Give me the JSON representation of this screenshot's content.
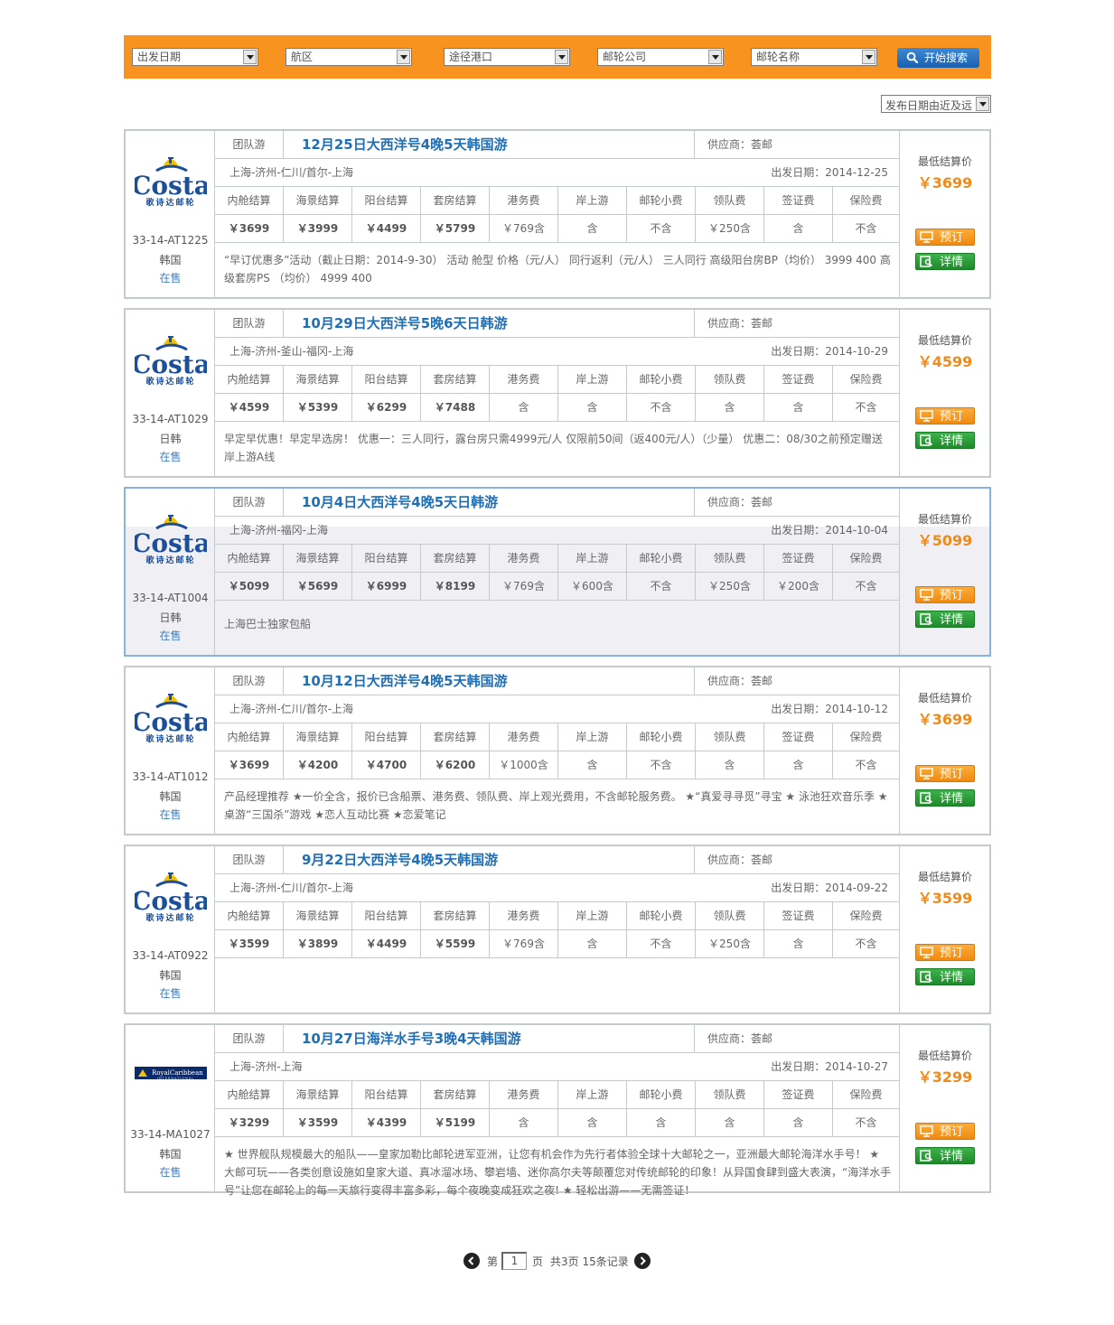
{
  "search": {
    "filters": [
      "出发日期",
      "航区",
      "途径港口",
      "邮轮公司",
      "邮轮名称"
    ],
    "button_label": "开始搜索",
    "sort_label": "发布日期由近及远"
  },
  "columns": [
    "内舱结算",
    "海景结算",
    "阳台结算",
    "套房结算",
    "港务费",
    "岸上游",
    "邮轮小费",
    "领队费",
    "签证费",
    "保险费"
  ],
  "labels": {
    "price_label": "最低结算价",
    "book": "预订",
    "detail": "详情",
    "status": "在售"
  },
  "colors": {
    "accent": "#f7931e",
    "title": "#1f6fb7",
    "price": "#f08a1a",
    "book_btn": "#f5a020",
    "detail_btn": "#2d9a3a"
  },
  "cruises": [
    {
      "logo": "Costa",
      "logo_text": "歌诗达邮轮",
      "code": "33-14-AT1225",
      "dest": "韩国",
      "type": "团队游",
      "title": "12月25日大西洋号4晚5天韩国游",
      "supplier": "供应商：荟邮",
      "route": "上海-济州-仁川/首尔-上海",
      "depart": "出发日期：2014-12-25",
      "prices": [
        "￥3699",
        "￥3999",
        "￥4499",
        "￥5799",
        "￥769含",
        "含",
        "不含",
        "￥250含",
        "含",
        "不含"
      ],
      "desc": "“早订优惠多”活动（截止日期：2014-9-30） 活动 舱型 价格（元/人） 同行返利（元/人） 三人同行 高级阳台房BP（均价） 3999 400 高级套房PS （均价） 4999 400",
      "min_price": "￥3699"
    },
    {
      "logo": "Costa",
      "logo_text": "歌诗达邮轮",
      "code": "33-14-AT1029",
      "dest": "日韩",
      "type": "团队游",
      "title": "10月29日大西洋号5晚6天日韩游",
      "supplier": "供应商：荟邮",
      "route": "上海-济州-釜山-福冈-上海",
      "depart": "出发日期：2014-10-29",
      "prices": [
        "￥4599",
        "￥5399",
        "￥6299",
        "￥7488",
        "含",
        "含",
        "不含",
        "含",
        "含",
        "不含"
      ],
      "desc": "早定早优惠！早定早选房！ 优惠一：三人同行，露台房只需4999元/人 仅限前50间（返400元/人）（少量） 优惠二：08/30之前预定赠送岸上游A线",
      "min_price": "￥4599"
    },
    {
      "logo": "Costa",
      "logo_text": "歌诗达邮轮",
      "code": "33-14-AT1004",
      "dest": "日韩",
      "type": "团队游",
      "title": "10月4日大西洋号4晚5天日韩游",
      "supplier": "供应商：荟邮",
      "route": "上海-济州-福冈-上海",
      "depart": "出发日期：2014-10-04",
      "prices": [
        "￥5099",
        "￥5699",
        "￥6999",
        "￥8199",
        "￥769含",
        "￥600含",
        "不含",
        "￥250含",
        "￥200含",
        "不含"
      ],
      "desc": "上海巴士独家包船",
      "min_price": "￥5099"
    },
    {
      "logo": "Costa",
      "logo_text": "歌诗达邮轮",
      "code": "33-14-AT1012",
      "dest": "韩国",
      "type": "团队游",
      "title": "10月12日大西洋号4晚5天韩国游",
      "supplier": "供应商：荟邮",
      "route": "上海-济州-仁川/首尔-上海",
      "depart": "出发日期：2014-10-12",
      "prices": [
        "￥3699",
        "￥4200",
        "￥4700",
        "￥6200",
        "￥1000含",
        "含",
        "不含",
        "含",
        "含",
        "不含"
      ],
      "desc": "产品经理推荐 ★一价全含，报价已含船票、港务费、领队费、岸上观光费用，不含邮轮服务费。 ★“真爱寻寻觅”寻宝 ★ 泳池狂欢音乐季 ★桌游“三国杀”游戏 ★恋人互动比赛 ★恋爱笔记",
      "min_price": "￥3699"
    },
    {
      "logo": "Costa",
      "logo_text": "歌诗达邮轮",
      "code": "33-14-AT0922",
      "dest": "韩国",
      "type": "团队游",
      "title": "9月22日大西洋号4晚5天韩国游",
      "supplier": "供应商：荟邮",
      "route": "上海-济州-仁川/首尔-上海",
      "depart": "出发日期：2014-09-22",
      "prices": [
        "￥3599",
        "￥3899",
        "￥4499",
        "￥5599",
        "￥769含",
        "含",
        "不含",
        "￥250含",
        "含",
        "不含"
      ],
      "desc": "",
      "min_price": "￥3599"
    },
    {
      "logo": "RoyalCaribbean",
      "logo_text": "RoyalCaribbean INTERNATIONAL",
      "code": "33-14-MA1027",
      "dest": "韩国",
      "type": "团队游",
      "title": "10月27日海洋水手号3晚4天韩国游",
      "supplier": "供应商：荟邮",
      "route": "上海-济州-上海",
      "depart": "出发日期：2014-10-27",
      "prices": [
        "￥3299",
        "￥3599",
        "￥4399",
        "￥5199",
        "含",
        "含",
        "含",
        "含",
        "含",
        "不含"
      ],
      "desc": "★ 世界舰队规模最大的船队——皇家加勒比邮轮进军亚洲，让您有机会作为先行者体验全球十大邮轮之一，亚洲最大邮轮海洋水手号！ ★ 大邮可玩——各类创意设施如皇家大道、真冰溜冰场、攀岩墙、迷你高尔夫等颠覆您对传统邮轮的印象！从异国食肆到盛大表演，“海洋水手号”让您在邮轮上的每一天旅行变得丰富多彩，每个夜晚变成狂欢之夜! ★ 轻松出游——无需签证！",
      "min_price": "￥3299"
    }
  ],
  "pager": {
    "prefix": "第",
    "page": "1",
    "suffix": "页",
    "info": "共3页 15条记录"
  }
}
